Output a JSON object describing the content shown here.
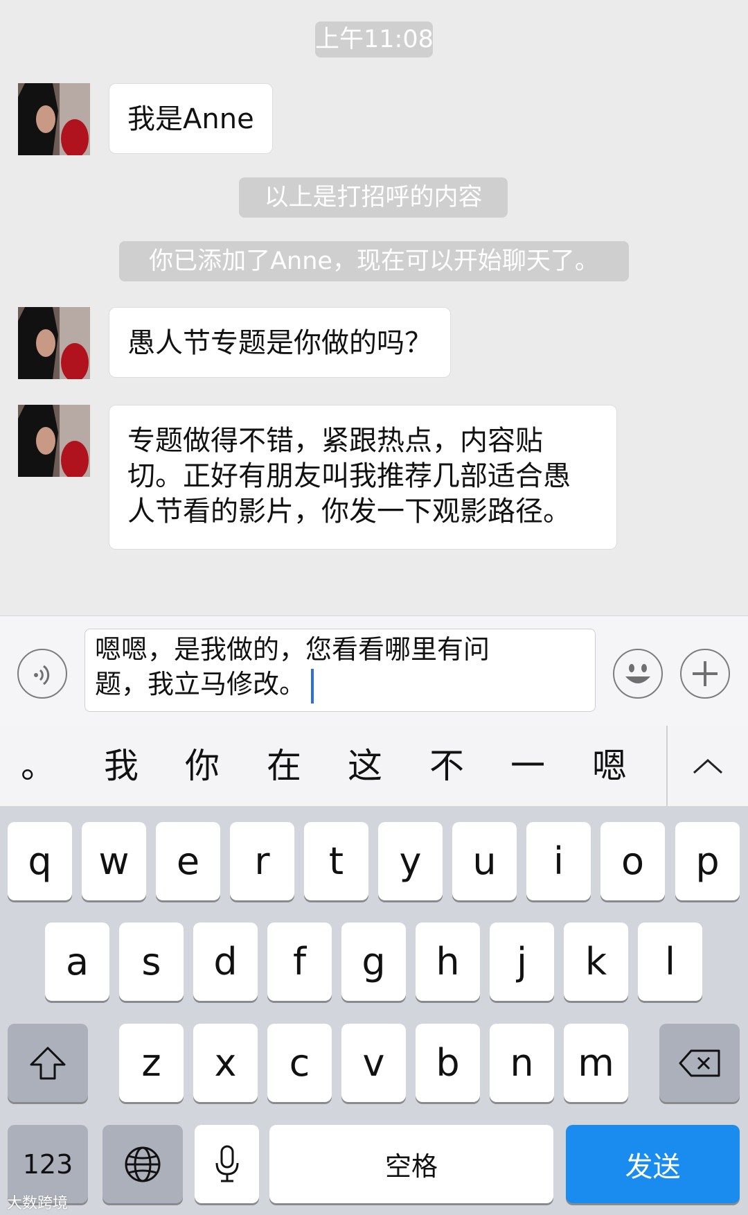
{
  "chat": {
    "timestamp": "上午11:08",
    "messages": [
      {
        "text": "我是Anne"
      },
      {
        "system": "以上是打招呼的内容"
      },
      {
        "system": "你已添加了Anne，现在可以开始聊天了。"
      },
      {
        "text": "愚人节专题是你做的吗？"
      },
      {
        "lines": [
          "专题做得不错，紧跟热点，内容贴",
          "切。正好有朋友叫我推荐几部适合愚",
          "人节看的影片，你发一下观影路径。"
        ]
      }
    ]
  },
  "input": {
    "lines": [
      "嗯嗯，是我做的，您看看哪里有问",
      "题，我立马修改。"
    ],
    "left_icon": "voice-icon",
    "right_icons": [
      "emoji-icon",
      "plus-icon"
    ]
  },
  "candidates": [
    "。",
    "我",
    "你",
    "在",
    "这",
    "不",
    "一",
    "嗯"
  ],
  "candidate_expand_icon": "chevron-up-icon",
  "keyboard": {
    "row1": [
      "q",
      "w",
      "e",
      "r",
      "t",
      "y",
      "u",
      "i",
      "o",
      "p"
    ],
    "row2": [
      "a",
      "s",
      "d",
      "f",
      "g",
      "h",
      "j",
      "k",
      "l"
    ],
    "row3": [
      "z",
      "x",
      "c",
      "v",
      "b",
      "n",
      "m"
    ],
    "numbers_label": "123",
    "space_label": "空格",
    "send_label": "发送",
    "shift_icon": "shift-icon",
    "delete_icon": "delete-icon",
    "globe_icon": "globe-icon",
    "mic_icon": "microphone-icon"
  },
  "colors": {
    "send": "#1a8cf0",
    "chat_background": "#ebebeb",
    "system_notice": "#cfcfcf",
    "caret": "#2f6fd8"
  },
  "watermark": "大数跨境"
}
